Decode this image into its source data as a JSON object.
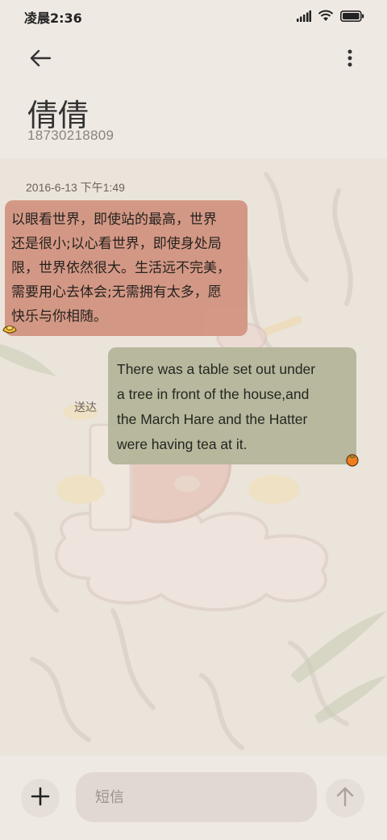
{
  "status_bar": {
    "time": "凌晨2:36",
    "icons": [
      "signal-icon",
      "wifi-icon",
      "battery-icon"
    ]
  },
  "header": {
    "back_icon": "back-arrow-icon",
    "more_icon": "more-vertical-icon",
    "contact_name": "倩倩",
    "contact_number": "18730218809"
  },
  "chat": {
    "timestamp": "2016-6-13 下午1:49",
    "messages": [
      {
        "direction": "incoming",
        "lines": [
          "以眼看世界，即使站的最高，世界",
          "还是很小;以心看世界，即使身处局",
          "限，世界依然很大。生活远不完美，",
          "需要用心去体会;无需拥有太多，愿",
          "快乐与你相随。"
        ],
        "bubble_color": "#d39683"
      },
      {
        "direction": "outgoing",
        "lines": [
          "There was a table set out under",
          "a tree in front of the house,and",
          "the March Hare and the Hatter",
          "were having tea at it."
        ],
        "status": "送达",
        "bubble_color": "#b6b79b"
      }
    ]
  },
  "composer": {
    "add_icon": "plus-icon",
    "placeholder": "短信",
    "value": "",
    "send_icon": "send-arrow-icon"
  }
}
